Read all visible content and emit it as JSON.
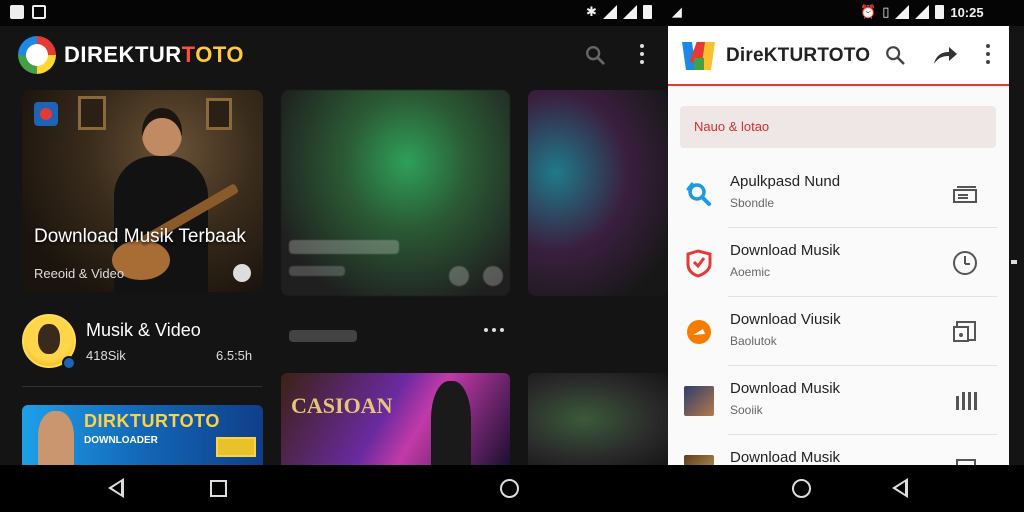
{
  "left_app": {
    "brand": {
      "part1": "DIREKTUR",
      "part2": "T",
      "part3": "OTO"
    },
    "featured": {
      "badge_text": "",
      "title": "Download Musik Terbaak",
      "subtitle": "Reeoid & Video"
    },
    "profile": {
      "name": "Musik & Video",
      "count": "418Sik",
      "duration": "6.5:5h"
    },
    "banner": {
      "title": "DIRKTURTOTO",
      "subtitle": "DOWNLOADER",
      "tag": ""
    },
    "concert": {
      "title": "CASIOAN"
    }
  },
  "panel": {
    "title": "DireKTURTOTO",
    "search_placeholder": "Nauo & lotao",
    "items": [
      {
        "title": "Apulkpasd Nund",
        "subtitle": "Sbondle",
        "lead_icon": "search-blue-icon",
        "trail_icon": "stack-icon"
      },
      {
        "title": "Download Musik",
        "subtitle": "Aoemic",
        "lead_icon": "shield-red-icon",
        "trail_icon": "download-clock-icon"
      },
      {
        "title": "Download Viusik",
        "subtitle": "Baolutok",
        "lead_icon": "orange-play-icon",
        "trail_icon": "media-card-icon"
      },
      {
        "title": "Download Musik",
        "subtitle": "Sooiik",
        "lead_icon": "thumbnail",
        "trail_icon": "equalizer-icon"
      },
      {
        "title": "Download Musik",
        "subtitle": "",
        "lead_icon": "thumbnail",
        "trail_icon": "media-card-icon"
      }
    ]
  },
  "status_bar": {
    "time": "10:25"
  },
  "colors": {
    "accent_red": "#e53935",
    "dark_bg": "#141414",
    "panel_bg": "#fafafa"
  }
}
